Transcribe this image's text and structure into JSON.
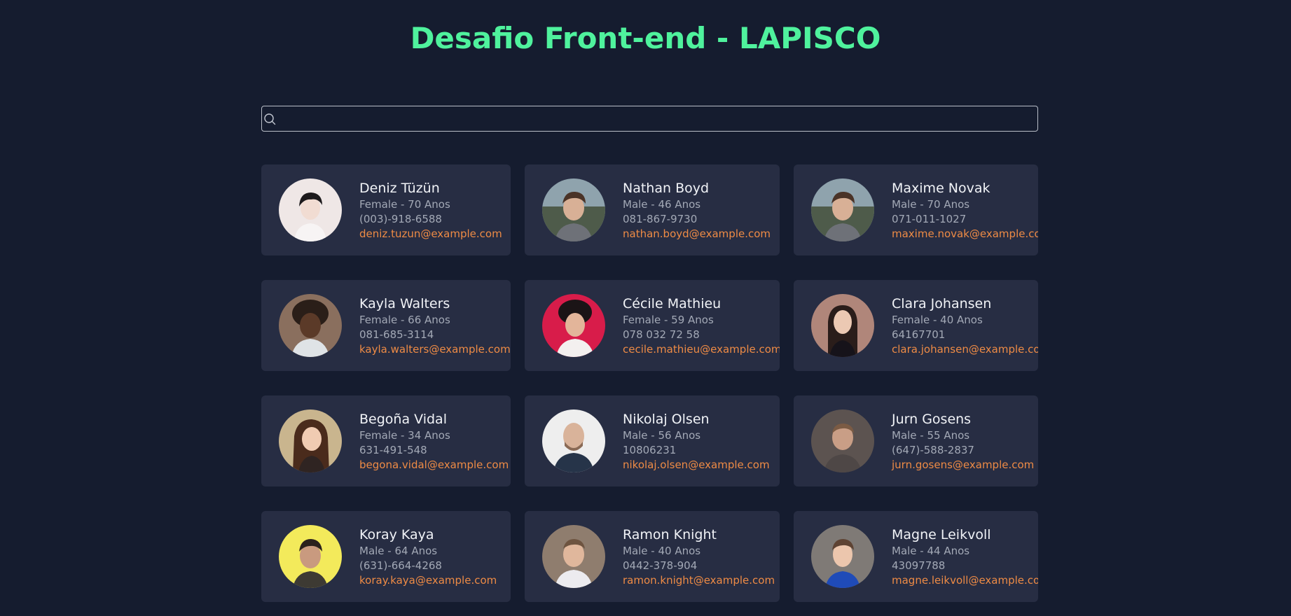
{
  "header": {
    "title": "Desafio Front-end - LAPISCO"
  },
  "search": {
    "value": ""
  },
  "colors": {
    "background": "#151c2f",
    "card": "#272d43",
    "title": "#4ff29d",
    "email": "#ee8b45",
    "meta": "#a3a9b6"
  },
  "users": [
    {
      "name": "Deniz Tüzün",
      "info": "Female - 70 Anos",
      "phone": "(003)-918-6588",
      "email": "deniz.tuzun@example.com"
    },
    {
      "name": "Nathan Boyd",
      "info": "Male - 46 Anos",
      "phone": "081-867-9730",
      "email": "nathan.boyd@example.com"
    },
    {
      "name": "Maxime Novak",
      "info": "Male - 70 Anos",
      "phone": "071-011-1027",
      "email": "maxime.novak@example.com"
    },
    {
      "name": "Kayla Walters",
      "info": "Female - 66 Anos",
      "phone": "081-685-3114",
      "email": "kayla.walters@example.com"
    },
    {
      "name": "Cécile Mathieu",
      "info": "Female - 59 Anos",
      "phone": "078 032 72 58",
      "email": "cecile.mathieu@example.com"
    },
    {
      "name": "Clara Johansen",
      "info": "Female - 40 Anos",
      "phone": "64167701",
      "email": "clara.johansen@example.com"
    },
    {
      "name": "Begoña Vidal",
      "info": "Female - 34 Anos",
      "phone": "631-491-548",
      "email": "begona.vidal@example.com"
    },
    {
      "name": "Nikolaj Olsen",
      "info": "Male - 56 Anos",
      "phone": "10806231",
      "email": "nikolaj.olsen@example.com"
    },
    {
      "name": "Jurn Gosens",
      "info": "Male - 55 Anos",
      "phone": "(647)-588-2837",
      "email": "jurn.gosens@example.com"
    },
    {
      "name": "Koray Kaya",
      "info": "Male - 64 Anos",
      "phone": "(631)-664-4268",
      "email": "koray.kaya@example.com"
    },
    {
      "name": "Ramon Knight",
      "info": "Male - 40 Anos",
      "phone": "0442-378-904",
      "email": "ramon.knight@example.com"
    },
    {
      "name": "Magne Leikvoll",
      "info": "Male - 44 Anos",
      "phone": "43097788",
      "email": "magne.leikvoll@example.com"
    }
  ]
}
